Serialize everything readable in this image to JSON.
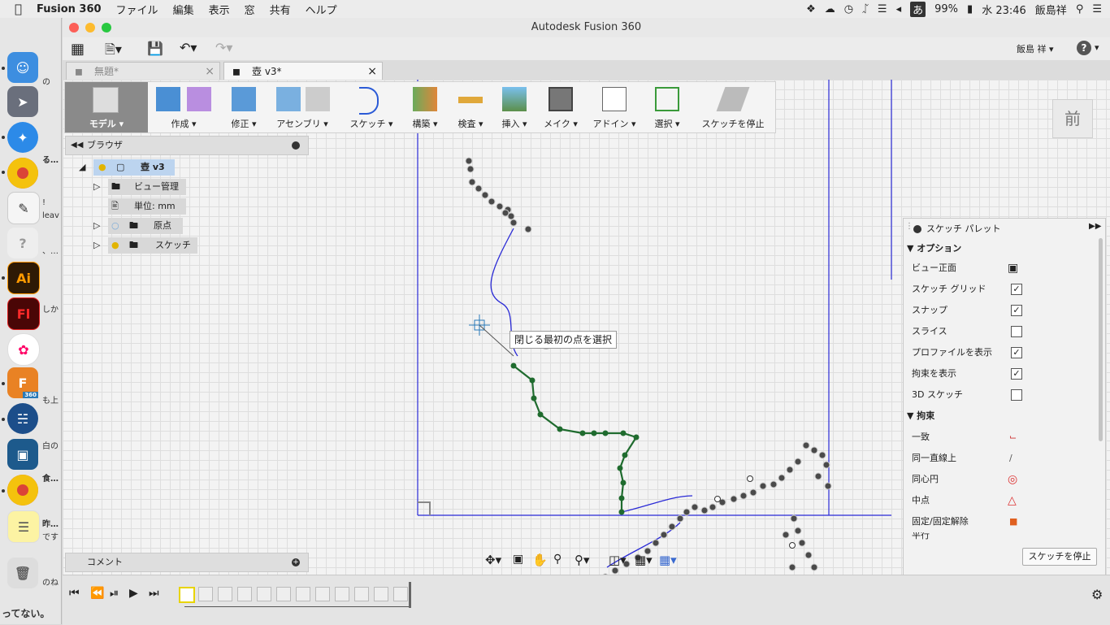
{
  "menubar": {
    "app_name": "Fusion 360",
    "items": [
      "ファイル",
      "編集",
      "表示",
      "窓",
      "共有",
      "ヘルプ"
    ],
    "ime": "あ",
    "battery": "99%",
    "clock": "水 23:46",
    "user": "飯島祥"
  },
  "dock": {
    "peek_texts": [
      "の",
      "る…",
      "!",
      "leav",
      "、…",
      "しか",
      "も上",
      "白の",
      "食…",
      "昨…",
      "です",
      "のね",
      "ってない。"
    ],
    "ai_label": "Ai",
    "fl_label": "Fl",
    "f360_badge": "360"
  },
  "window": {
    "title": "Autodesk Fusion 360",
    "user_menu": "飯島 祥 ▾",
    "help": "?"
  },
  "tabs": [
    {
      "label": "無題*"
    },
    {
      "label": "壺 v3*"
    }
  ],
  "toolbar": {
    "workspace": "モデル ▾",
    "create": "作成 ▾",
    "modify": "修正 ▾",
    "assemble": "アセンブリ ▾",
    "sketch": "スケッチ ▾",
    "construct": "構築 ▾",
    "inspect": "検査 ▾",
    "insert": "挿入 ▾",
    "make": "メイク ▾",
    "addins": "アドイン ▾",
    "select": "選択 ▾",
    "stop_sketch": "スケッチを停止"
  },
  "browser": {
    "title": "ブラウザ",
    "root": "壺 v3",
    "items": [
      {
        "label": "ビュー管理"
      },
      {
        "label": "単位: mm"
      },
      {
        "label": "原点"
      },
      {
        "label": "スケッチ"
      }
    ]
  },
  "comment": {
    "title": "コメント"
  },
  "viewcube": {
    "face": "前"
  },
  "tooltip": {
    "text": "閉じる最初の点を選択"
  },
  "palette": {
    "title": "スケッチ パレット",
    "options_header": "オプション",
    "options": [
      {
        "label": "ビュー正面",
        "checked": null
      },
      {
        "label": "スケッチ グリッド",
        "checked": true
      },
      {
        "label": "スナップ",
        "checked": true
      },
      {
        "label": "スライス",
        "checked": false
      },
      {
        "label": "プロファイルを表示",
        "checked": true
      },
      {
        "label": "拘束を表示",
        "checked": true
      },
      {
        "label": "3D スケッチ",
        "checked": false
      }
    ],
    "constraints_header": "拘束",
    "constraints": [
      {
        "label": "一致"
      },
      {
        "label": "同一直線上"
      },
      {
        "label": "同心円"
      },
      {
        "label": "中点"
      },
      {
        "label": "固定/固定解除"
      },
      {
        "label": "平行"
      }
    ],
    "stop_button": "スケッチを停止"
  },
  "colors": {
    "sketch_line": "#2a2ad6",
    "selected_path": "#1f6b2e",
    "points": "#4a4a4a"
  }
}
